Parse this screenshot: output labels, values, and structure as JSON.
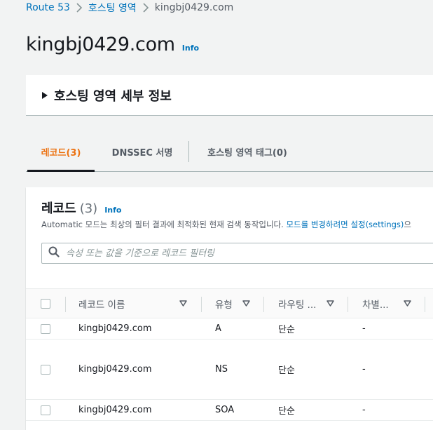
{
  "breadcrumb": {
    "items": [
      "Route 53",
      "호스팅 영역",
      "kingbj0429.com"
    ]
  },
  "title": {
    "text": "kingbj0429.com",
    "info": "Info"
  },
  "details": {
    "label": "호스팅 영역 세부 정보"
  },
  "tabs": [
    "레코드(3)",
    "DNSSEC 서명",
    "호스팅 영역 태그(0)"
  ],
  "records": {
    "heading": "레코드",
    "count": "(3)",
    "info": "Info",
    "description_prefix": "Automatic 모드는 최상의 필터 결과에 최적화된 현재 검색 동작입니다. ",
    "description_link": "모드를 변경하려면 설정(settings)",
    "description_suffix": "으",
    "filter_placeholder": "속성 또는 값을 기준으로 레코드 필터링",
    "columns": [
      "레코드 이름",
      "유형",
      "라우팅 ...",
      "차별..."
    ],
    "rows": [
      {
        "name": "kingbj0429.com",
        "type": "A",
        "routing": "단순",
        "diff": "-"
      },
      {
        "name": "kingbj0429.com",
        "type": "NS",
        "routing": "단순",
        "diff": "-"
      },
      {
        "name": "kingbj0429.com",
        "type": "SOA",
        "routing": "단순",
        "diff": "-"
      }
    ]
  },
  "colors": {
    "link": "#0073bb",
    "active_tab": "#ec7211",
    "text": "#16191f",
    "muted": "#545b64"
  }
}
